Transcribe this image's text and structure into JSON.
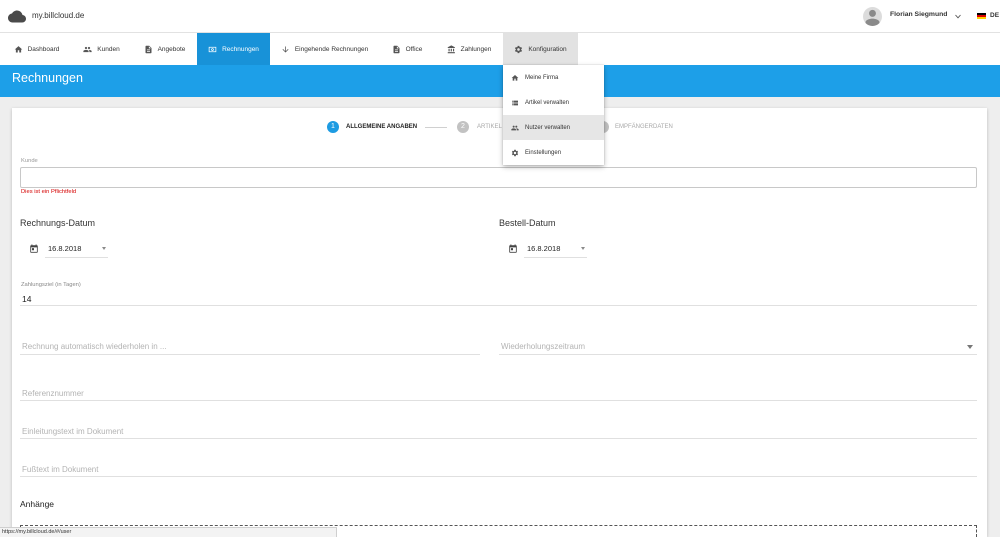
{
  "header": {
    "site_name": "my.billcloud.de",
    "logo_icon": "cloud-icon",
    "user_name": "Florian Siegmund",
    "language": "DE"
  },
  "nav": {
    "tabs": [
      {
        "label": "Dashboard",
        "icon": "home-icon"
      },
      {
        "label": "Kunden",
        "icon": "people-icon"
      },
      {
        "label": "Angebote",
        "icon": "document-icon"
      },
      {
        "label": "Rechnungen",
        "icon": "money-icon",
        "active": true
      },
      {
        "label": "Eingehende Rechnungen",
        "icon": "arrow-down-icon"
      },
      {
        "label": "Office",
        "icon": "document-icon"
      },
      {
        "label": "Zahlungen",
        "icon": "bank-icon"
      },
      {
        "label": "Konfiguration",
        "icon": "gear-icon",
        "menu_open": true
      }
    ]
  },
  "config_menu": {
    "items": [
      {
        "label": "Meine Firma",
        "icon": "home-icon"
      },
      {
        "label": "Artikel verwalten",
        "icon": "list-icon"
      },
      {
        "label": "Nutzer verwalten",
        "icon": "people-icon",
        "hovered": true
      },
      {
        "label": "Einstellungen",
        "icon": "gear-icon"
      }
    ]
  },
  "page": {
    "title": "Rechnungen"
  },
  "stepper": {
    "steps": [
      {
        "number": "1",
        "label": "ALLGEMEINE ANGABEN",
        "active": true
      },
      {
        "number": "2",
        "label": "ARTIKEL",
        "active": false
      },
      {
        "label": "EMPFÄNGERDATEN",
        "active": false
      }
    ]
  },
  "form": {
    "customer": {
      "label": "Kunde",
      "value": "",
      "error": "Dies ist ein Pflichtfeld"
    },
    "invoice_date": {
      "label": "Rechnungs-Datum",
      "value": "16.8.2018"
    },
    "order_date": {
      "label": "Bestell-Datum",
      "value": "16.8.2018"
    },
    "payment_term": {
      "label": "Zahlungsziel (in Tagen)",
      "value": "14"
    },
    "repeat_in": {
      "placeholder": "Rechnung automatisch wiederholen in ..."
    },
    "repeat_period": {
      "placeholder": "Wiederholungszeitraum"
    },
    "reference": {
      "placeholder": "Referenznummer"
    },
    "intro_text": {
      "placeholder": "Einleitungstext im Dokument"
    },
    "footer_text": {
      "placeholder": "Fußtext im Dokument"
    },
    "attachments": {
      "label": "Anhänge"
    }
  },
  "status_bar": {
    "url": "https://my.billcloud.de/#/user"
  },
  "colors": {
    "primary": "#1d9fe8",
    "active_tab": "#1892d8",
    "step_active": "#1d9be2",
    "error": "#d50000"
  }
}
